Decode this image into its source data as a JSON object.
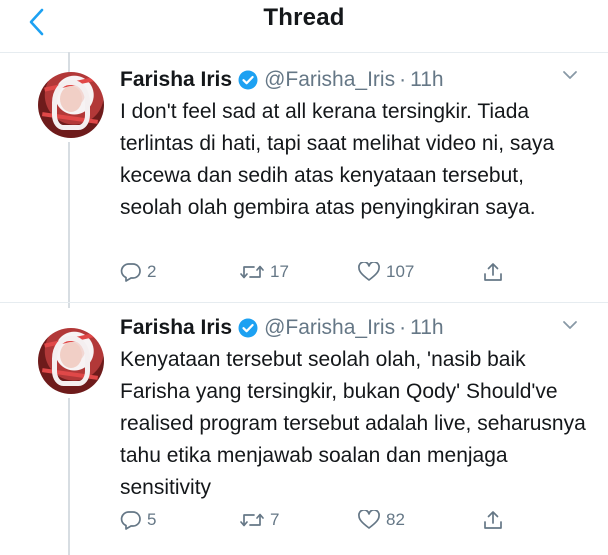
{
  "header": {
    "title": "Thread"
  },
  "colors": {
    "accent": "#1da1f2",
    "muted": "#657786",
    "text": "#14171a"
  },
  "tweets": [
    {
      "name": "Farisha Iris",
      "handle": "@Farisha_Iris",
      "separator": "·",
      "time": "11h",
      "text": "I don't feel sad at all kerana tersingkir. Tiada terlintas di hati, tapi saat melihat video ni, saya kecewa dan sedih atas kenyataan tersebut, seolah olah gembira atas penyingkiran saya.",
      "replies": "2",
      "retweets": "17",
      "likes": "107"
    },
    {
      "name": "Farisha Iris",
      "handle": "@Farisha_Iris",
      "separator": "·",
      "time": "11h",
      "text": "Kenyataan tersebut seolah olah, 'nasib baik Farisha yang tersingkir, bukan Qody' Should've realised program tersebut adalah live, seharusnya tahu etika menjawab soalan dan menjaga sensitivity",
      "replies": "5",
      "retweets": "7",
      "likes": "82"
    }
  ]
}
